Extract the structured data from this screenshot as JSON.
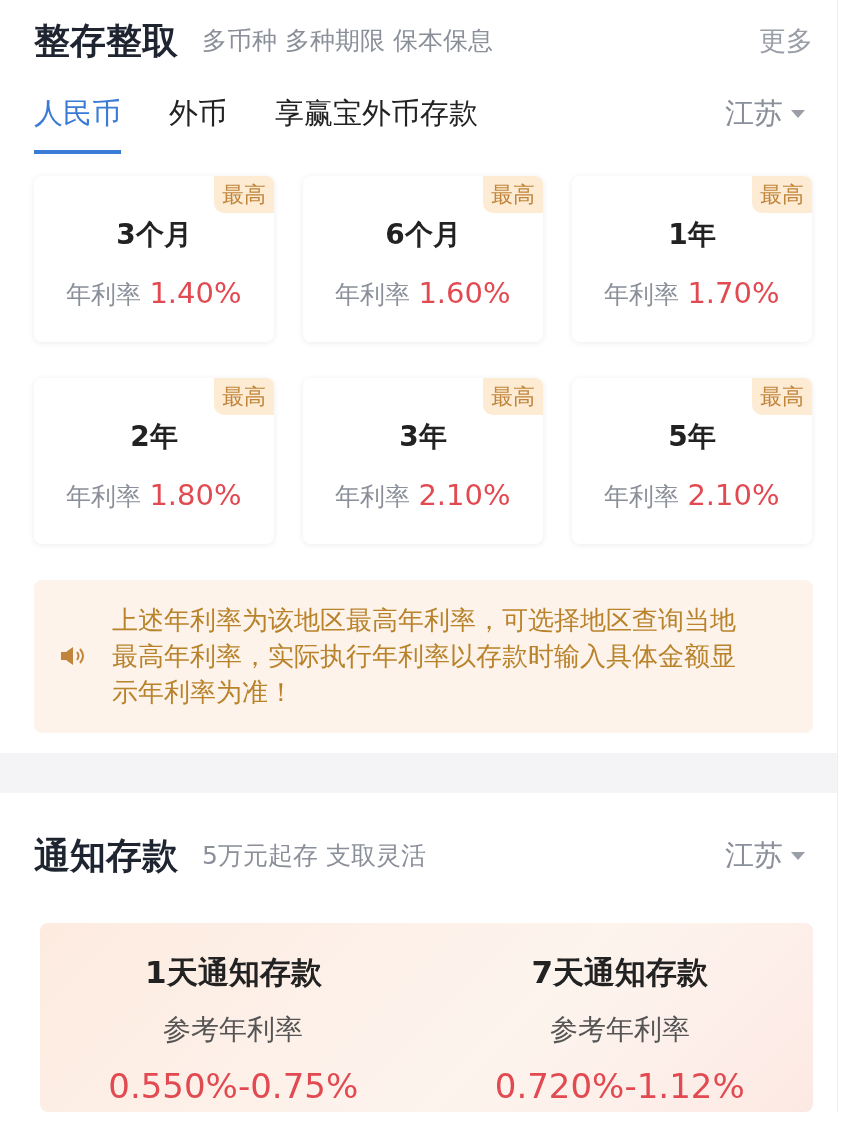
{
  "fixed_deposit": {
    "title": "整存整取",
    "subtitle": "多币种 多种期限 保本保息",
    "more": "更多"
  },
  "tabs": [
    {
      "label": "人民币",
      "selected": true
    },
    {
      "label": "外币",
      "selected": false
    },
    {
      "label": "享赢宝外币存款",
      "selected": false
    }
  ],
  "region": {
    "label": "江苏"
  },
  "rate_cards": [
    {
      "badge": "最高",
      "term": "3个月",
      "rate_label": "年利率",
      "rate": "1.40%"
    },
    {
      "badge": "最高",
      "term": "6个月",
      "rate_label": "年利率",
      "rate": "1.60%"
    },
    {
      "badge": "最高",
      "term": "1年",
      "rate_label": "年利率",
      "rate": "1.70%"
    },
    {
      "badge": "最高",
      "term": "2年",
      "rate_label": "年利率",
      "rate": "1.80%"
    },
    {
      "badge": "最高",
      "term": "3年",
      "rate_label": "年利率",
      "rate": "2.10%"
    },
    {
      "badge": "最高",
      "term": "5年",
      "rate_label": "年利率",
      "rate": "2.10%"
    }
  ],
  "notice": {
    "text": "上述年利率为该地区最高年利率，可选择地区查询当地最高年利率，实际执行年利率以存款时输入具体金额显示年利率为准！"
  },
  "call_deposit": {
    "title": "通知存款",
    "subtitle": "5万元起存 支取灵活",
    "region": "江苏",
    "products": [
      {
        "name": "1天通知存款",
        "rate_label": "参考年利率",
        "rate": "0.550%-0.75%"
      },
      {
        "name": "7天通知存款",
        "rate_label": "参考年利率",
        "rate": "0.720%-1.12%"
      }
    ]
  }
}
